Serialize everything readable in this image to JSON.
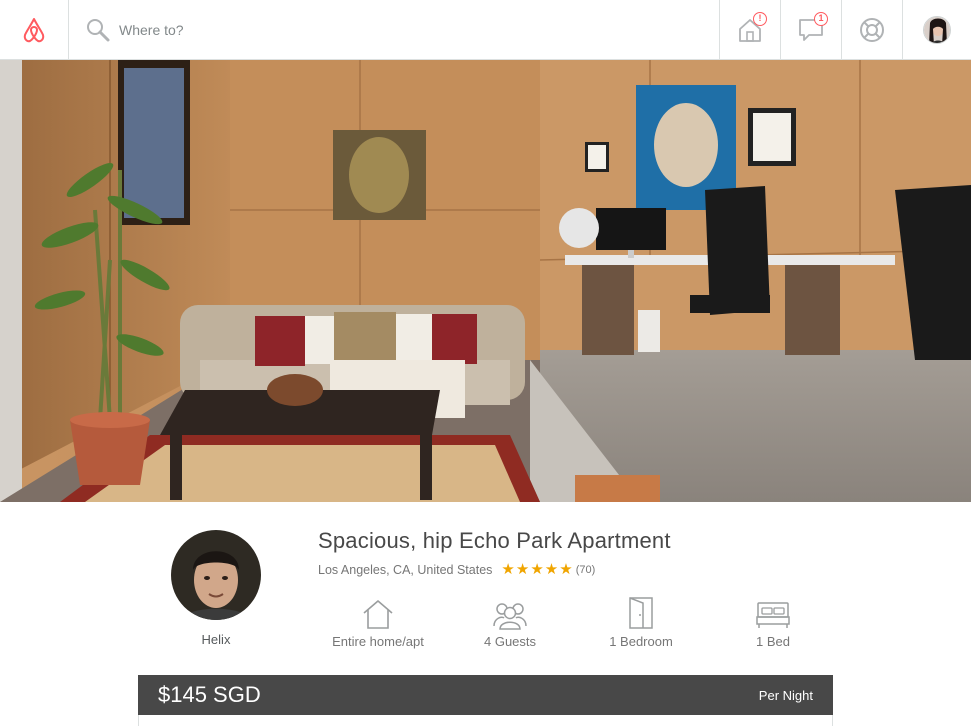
{
  "nav": {
    "search_placeholder": "Where to?",
    "hosting_badge": "!",
    "messages_badge": "1",
    "icons": [
      "airbnb-logo",
      "search-icon",
      "host-home-icon",
      "messages-icon",
      "help-icon",
      "user-avatar"
    ]
  },
  "listing": {
    "title": "Spacious, hip Echo Park Apartment",
    "location": "Los Angeles, CA, United States",
    "rating": 5,
    "review_count": "(70)",
    "host_name": "Helix",
    "amenities": [
      {
        "icon": "home-icon",
        "label": "Entire home/apt"
      },
      {
        "icon": "guests-icon",
        "label": "4 Guests"
      },
      {
        "icon": "door-icon",
        "label": "1 Bedroom"
      },
      {
        "icon": "bed-icon",
        "label": "1 Bed"
      }
    ],
    "price": "$145 SGD",
    "price_unit": "Per Night"
  },
  "colors": {
    "brand": "#ff5a5f",
    "star": "#f0a500",
    "price_bar": "#484848"
  }
}
